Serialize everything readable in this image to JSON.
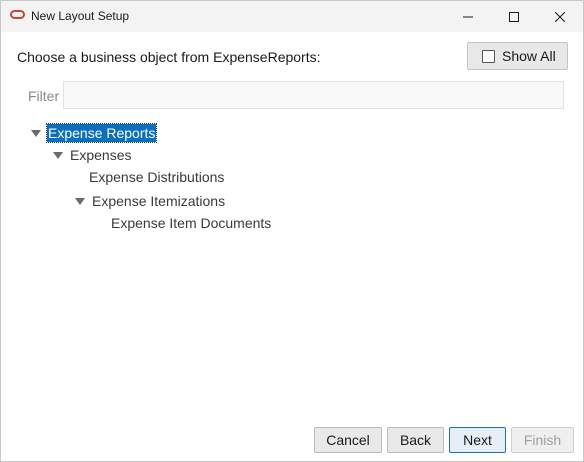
{
  "window": {
    "title": "New Layout Setup",
    "controls": {
      "minimize": "minimize-icon",
      "maximize": "maximize-icon",
      "close": "close-icon"
    }
  },
  "header": {
    "prompt": "Choose a business object from ExpenseReports:",
    "show_all_label": "Show All",
    "show_all_checked": false
  },
  "filter": {
    "label": "Filter",
    "value": "",
    "placeholder": ""
  },
  "tree": {
    "nodes": [
      {
        "label": "Expense Reports",
        "level": 0,
        "expanded": true,
        "selected": true
      },
      {
        "label": "Expenses",
        "level": 1,
        "expanded": true,
        "selected": false
      },
      {
        "label": "Expense Distributions",
        "level": 2,
        "expanded": false,
        "selected": false
      },
      {
        "label": "Expense Itemizations",
        "level": 2,
        "expanded": true,
        "selected": false
      },
      {
        "label": "Expense Item Documents",
        "level": 3,
        "expanded": false,
        "selected": false
      }
    ]
  },
  "footer": {
    "cancel": "Cancel",
    "back": "Back",
    "next": "Next",
    "finish": "Finish"
  },
  "colors": {
    "selection": "#0a6fbd",
    "brand_icon": "#c74634",
    "primary_border": "#1f6fc2"
  }
}
